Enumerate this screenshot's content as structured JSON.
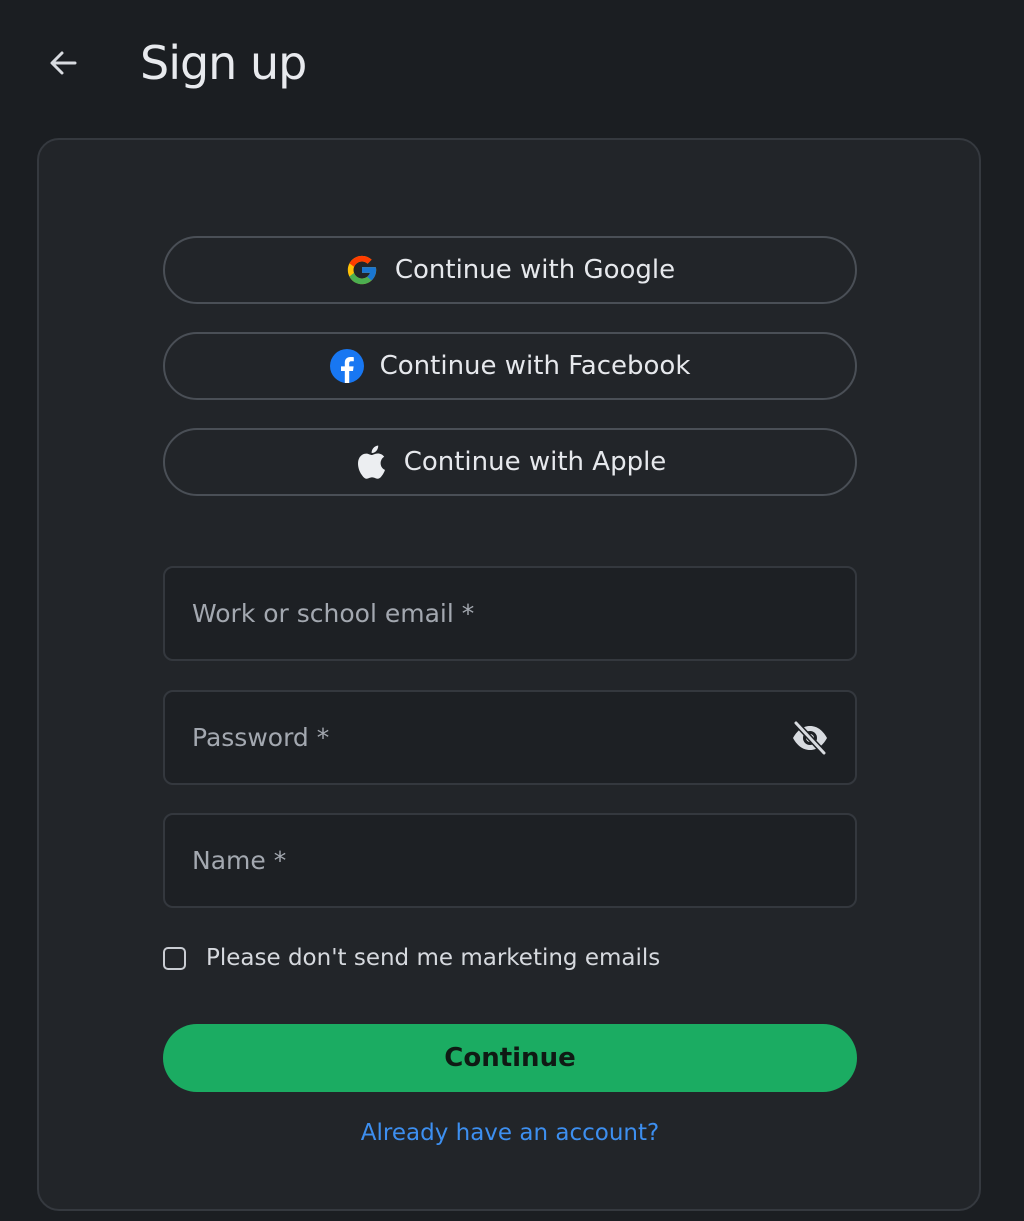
{
  "header": {
    "back_icon": "arrow-left-icon",
    "title": "Sign up"
  },
  "social": {
    "google": {
      "label": "Continue with Google",
      "icon": "google-icon"
    },
    "facebook": {
      "label": "Continue with Facebook",
      "icon": "facebook-icon",
      "color": "#1877f2"
    },
    "apple": {
      "label": "Continue with Apple",
      "icon": "apple-icon"
    }
  },
  "form": {
    "email": {
      "placeholder": "Work or school email *",
      "value": ""
    },
    "password": {
      "placeholder": "Password *",
      "value": "",
      "toggle_icon": "eye-off-icon"
    },
    "name": {
      "placeholder": "Name *",
      "value": ""
    },
    "marketing_opt_out": {
      "label": "Please don't send me marketing emails",
      "checked": false
    }
  },
  "actions": {
    "continue_label": "Continue",
    "continue_color": "#1bac62",
    "signin_link": "Already have an account?",
    "link_color": "#3d8ff0"
  }
}
